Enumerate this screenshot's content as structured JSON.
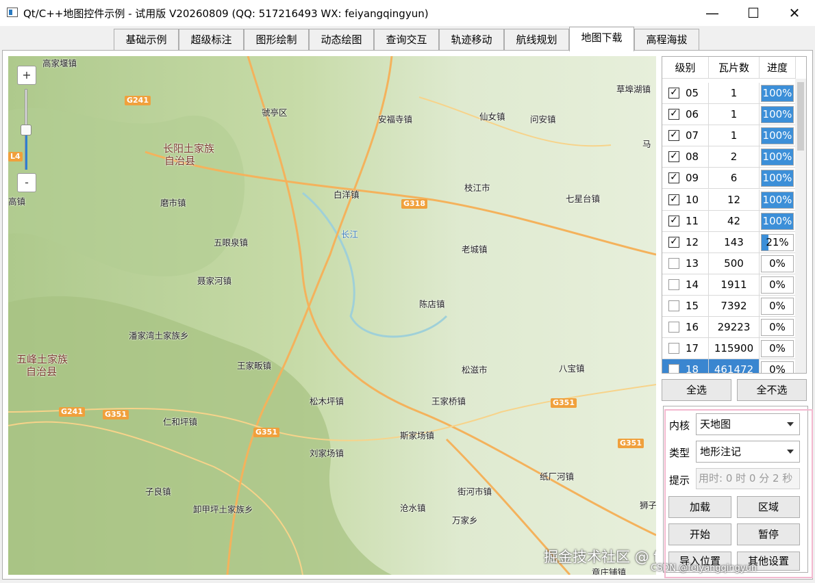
{
  "window": {
    "title": "Qt/C++地图控件示例 - 试用版 V20260809 (QQ: 517216493 WX: feiyangqingyun)",
    "minimize": "—",
    "maximize": "☐",
    "close": "✕"
  },
  "tabs": [
    {
      "label": "基础示例",
      "active": false
    },
    {
      "label": "超级标注",
      "active": false
    },
    {
      "label": "图形绘制",
      "active": false
    },
    {
      "label": "动态绘图",
      "active": false
    },
    {
      "label": "查询交互",
      "active": false
    },
    {
      "label": "轨迹移动",
      "active": false
    },
    {
      "label": "航线规划",
      "active": false
    },
    {
      "label": "地图下载",
      "active": true
    },
    {
      "label": "高程海拔",
      "active": false
    }
  ],
  "map": {
    "zoom_in": "+",
    "zoom_out": "-",
    "zoom_level_fraction": 0.55,
    "places": [
      {
        "name": "高家堰镇",
        "big": false
      },
      {
        "name": "虢亭区",
        "big": false
      },
      {
        "name": "安福寺镇",
        "big": false
      },
      {
        "name": "仙女镇",
        "big": false
      },
      {
        "name": "问安镇",
        "big": false
      },
      {
        "name": "草埠湖镇",
        "big": false
      },
      {
        "name": "长阳土家族",
        "big": true
      },
      {
        "name": "自治县",
        "big": true
      },
      {
        "name": "马",
        "big": false
      },
      {
        "name": "磨市镇",
        "big": false
      },
      {
        "name": "白洋镇",
        "big": false
      },
      {
        "name": "枝江市",
        "big": false
      },
      {
        "name": "七星台镇",
        "big": false
      },
      {
        "name": "高镇",
        "big": false
      },
      {
        "name": "五眼泉镇",
        "big": false
      },
      {
        "name": "长江",
        "big": false
      },
      {
        "name": "老城镇",
        "big": false
      },
      {
        "name": "聂家河镇",
        "big": false
      },
      {
        "name": "陈店镇",
        "big": false
      },
      {
        "name": "潘家湾土家族乡",
        "big": false
      },
      {
        "name": "五峰土家族",
        "big": true
      },
      {
        "name": "自治县",
        "big": true
      },
      {
        "name": "王家畈镇",
        "big": false
      },
      {
        "name": "松滋市",
        "big": false
      },
      {
        "name": "八宝镇",
        "big": false
      },
      {
        "name": "松木坪镇",
        "big": false
      },
      {
        "name": "王家桥镇",
        "big": false
      },
      {
        "name": "仁和坪镇",
        "big": false
      },
      {
        "name": "斯家场镇",
        "big": false
      },
      {
        "name": "刘家场镇",
        "big": false
      },
      {
        "name": "纸厂河镇",
        "big": false
      },
      {
        "name": "子良镇",
        "big": false
      },
      {
        "name": "街河市镇",
        "big": false
      },
      {
        "name": "卸甲坪土家族乡",
        "big": false
      },
      {
        "name": "沧水镇",
        "big": false
      },
      {
        "name": "狮子",
        "big": false
      },
      {
        "name": "万家乡",
        "big": false
      },
      {
        "name": "章庄铺镇",
        "big": false
      }
    ],
    "roads": [
      "G241",
      "G318",
      "G351",
      "G351",
      "G351",
      "G351",
      "G241",
      "L4"
    ],
    "watermark": "掘金技术社区 @ feiyangqingyun",
    "watermark_small": "CSDN @feiyangqingyun"
  },
  "tile_table": {
    "headers": [
      "级别",
      "瓦片数",
      "进度"
    ],
    "rows": [
      {
        "level": "05",
        "tiles": "1",
        "progress": "100%",
        "fill": 1.0,
        "checked": true,
        "selected": false
      },
      {
        "level": "06",
        "tiles": "1",
        "progress": "100%",
        "fill": 1.0,
        "checked": true,
        "selected": false
      },
      {
        "level": "07",
        "tiles": "1",
        "progress": "100%",
        "fill": 1.0,
        "checked": true,
        "selected": false
      },
      {
        "level": "08",
        "tiles": "2",
        "progress": "100%",
        "fill": 1.0,
        "checked": true,
        "selected": false
      },
      {
        "level": "09",
        "tiles": "6",
        "progress": "100%",
        "fill": 1.0,
        "checked": true,
        "selected": false
      },
      {
        "level": "10",
        "tiles": "12",
        "progress": "100%",
        "fill": 1.0,
        "checked": true,
        "selected": false
      },
      {
        "level": "11",
        "tiles": "42",
        "progress": "100%",
        "fill": 1.0,
        "checked": true,
        "selected": false
      },
      {
        "level": "12",
        "tiles": "143",
        "progress": "21%",
        "fill": 0.21,
        "checked": true,
        "selected": false
      },
      {
        "level": "13",
        "tiles": "500",
        "progress": "0%",
        "fill": 0,
        "checked": false,
        "selected": false
      },
      {
        "level": "14",
        "tiles": "1911",
        "progress": "0%",
        "fill": 0,
        "checked": false,
        "selected": false
      },
      {
        "level": "15",
        "tiles": "7392",
        "progress": "0%",
        "fill": 0,
        "checked": false,
        "selected": false
      },
      {
        "level": "16",
        "tiles": "29223",
        "progress": "0%",
        "fill": 0,
        "checked": false,
        "selected": false
      },
      {
        "level": "17",
        "tiles": "115900",
        "progress": "0%",
        "fill": 0,
        "checked": false,
        "selected": false
      },
      {
        "level": "18",
        "tiles": "461472",
        "progress": "0%",
        "fill": 0,
        "checked": false,
        "selected": true
      }
    ]
  },
  "select_buttons": {
    "select_all": "全选",
    "select_none": "全不选"
  },
  "form": {
    "kernel_label": "内核",
    "kernel_value": "天地图",
    "type_label": "类型",
    "type_value": "地形注记",
    "hint_label": "提示",
    "hint_value": "用时: 0 时 0 分 2 秒",
    "load_button": "加载",
    "region_button": "区域",
    "start_button": "开始",
    "pause_button": "暂停",
    "import_button": "导入位置",
    "other_button": "其他设置"
  }
}
